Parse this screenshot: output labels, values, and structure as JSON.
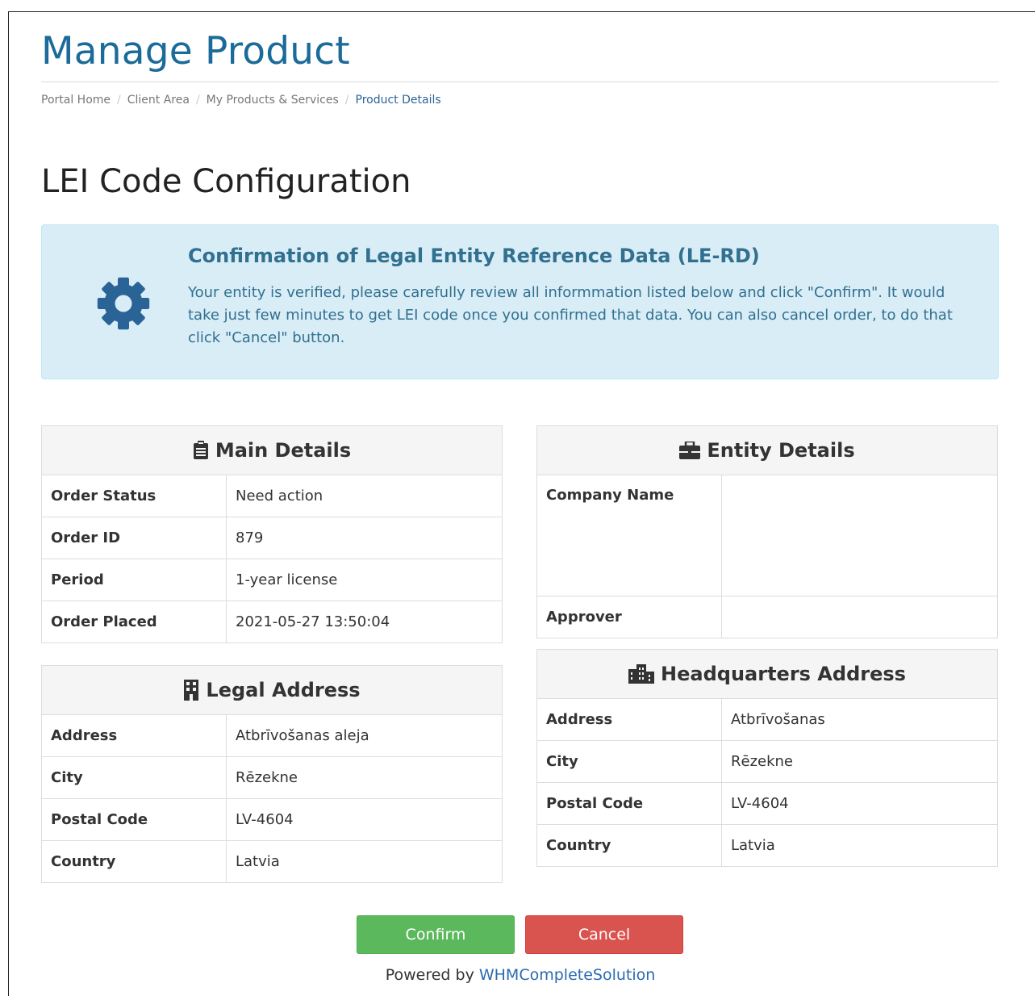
{
  "page": {
    "title": "Manage Product",
    "heading": "LEI Code Configuration"
  },
  "breadcrumb": [
    {
      "label": "Portal Home"
    },
    {
      "label": "Client Area"
    },
    {
      "label": "My Products & Services"
    },
    {
      "label": "Product Details"
    }
  ],
  "alert": {
    "icon": "gear-icon",
    "title": "Confirmation of Legal Entity Reference Data (LE-RD)",
    "text": "Your entity is verified, please carefully review all informmation listed below and click \"Confirm\". It would take just few minutes to get LEI code once you confirmed that data. You can also cancel order, to do that click \"Cancel\" button."
  },
  "main_details": {
    "icon": "clipboard-icon",
    "title": "Main Details",
    "rows": [
      {
        "label": "Order Status",
        "value": "Need action"
      },
      {
        "label": "Order ID",
        "value": "879"
      },
      {
        "label": "Period",
        "value": "1-year license"
      },
      {
        "label": "Order Placed",
        "value": "2021-05-27 13:50:04"
      }
    ]
  },
  "legal_address": {
    "icon": "building-icon",
    "title": "Legal Address",
    "rows": [
      {
        "label": "Address",
        "value": "Atbrīvošanas aleja"
      },
      {
        "label": "City",
        "value": "Rēzekne"
      },
      {
        "label": "Postal Code",
        "value": "LV-4604"
      },
      {
        "label": "Country",
        "value": "Latvia"
      }
    ]
  },
  "entity_details": {
    "icon": "briefcase-icon",
    "title": "Entity Details",
    "rows": [
      {
        "label": "Company Name",
        "value": ""
      },
      {
        "label": "Approver",
        "value": ""
      }
    ]
  },
  "headquarters_address": {
    "icon": "city-icon",
    "title": "Headquarters Address",
    "rows": [
      {
        "label": "Address",
        "value": "Atbrīvošanas"
      },
      {
        "label": "City",
        "value": "Rēzekne"
      },
      {
        "label": "Postal Code",
        "value": "LV-4604"
      },
      {
        "label": "Country",
        "value": "Latvia"
      }
    ]
  },
  "actions": {
    "confirm_label": "Confirm",
    "cancel_label": "Cancel",
    "confirm_color": "#5cb85c",
    "cancel_color": "#d9534f"
  },
  "footer": {
    "powered_by": "Powered by",
    "link_label": "WHMCompleteSolution"
  },
  "colors": {
    "title": "#1a6a9a",
    "alert_bg": "#d9edf7",
    "alert_text": "#31708f",
    "link": "#2a6ab0"
  }
}
